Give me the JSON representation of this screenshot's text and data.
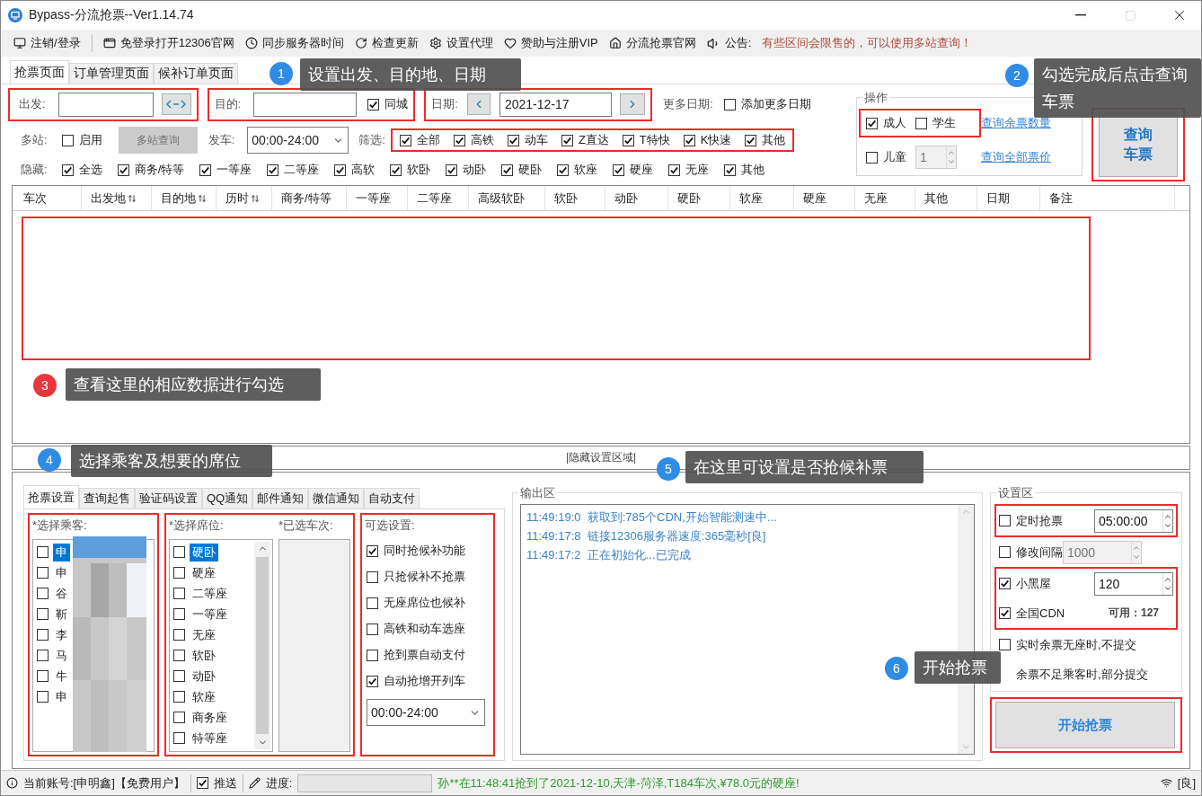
{
  "window": {
    "title": "Bypass-分流抢票--Ver1.14.74"
  },
  "toolbar": [
    {
      "kind": "monitor",
      "label": "注销/登录"
    },
    {
      "kind": "window",
      "label": "免登录打开12306官网"
    },
    {
      "kind": "clock",
      "label": "同步服务器时间"
    },
    {
      "kind": "refresh",
      "label": "检查更新"
    },
    {
      "kind": "gear",
      "label": "设置代理"
    },
    {
      "kind": "heart",
      "label": "赞助与注册VIP"
    },
    {
      "kind": "home",
      "label": "分流抢票官网"
    }
  ],
  "notice": {
    "label": "公告:",
    "text": "有些区间会限售的，可以使用多站查询！"
  },
  "tabs": [
    {
      "label": "抢票页面",
      "selected": true
    },
    {
      "label": "订单管理页面",
      "selected": false
    },
    {
      "label": "候补订单页面",
      "selected": false
    }
  ],
  "query": {
    "from": {
      "label": "出发:"
    },
    "to": {
      "label": "目的:"
    },
    "same_city": {
      "label": "同城",
      "checked": true
    },
    "date": {
      "label": "日期:",
      "value": "2021-12-17"
    },
    "more_dates": {
      "label": "更多日期:",
      "option": {
        "label": "添加更多日期",
        "checked": false
      }
    },
    "multi_station": {
      "label": "多站:",
      "enable": {
        "label": "启用",
        "checked": false
      },
      "button": {
        "label": "多站查询",
        "disabled": true
      }
    },
    "depart": {
      "label": "发车:",
      "value": "00:00-24:00"
    },
    "filter": {
      "label": "筛选:",
      "options": [
        {
          "label": "全部",
          "checked": true
        },
        {
          "label": "高铁",
          "checked": true
        },
        {
          "label": "动车",
          "checked": true
        },
        {
          "label": "Z直达",
          "checked": true
        },
        {
          "label": "T特快",
          "checked": true
        },
        {
          "label": "K快速",
          "checked": true
        },
        {
          "label": "其他",
          "checked": true
        }
      ]
    },
    "hide": {
      "label": "隐藏:",
      "options": [
        {
          "label": "全选",
          "checked": true
        },
        {
          "label": "商务/特等",
          "checked": true
        },
        {
          "label": "一等座",
          "checked": true
        },
        {
          "label": "二等座",
          "checked": true
        },
        {
          "label": "高软",
          "checked": true
        },
        {
          "label": "软卧",
          "checked": true
        },
        {
          "label": "动卧",
          "checked": true
        },
        {
          "label": "硬卧",
          "checked": true
        },
        {
          "label": "软座",
          "checked": true
        },
        {
          "label": "硬座",
          "checked": true
        },
        {
          "label": "无座",
          "checked": true
        },
        {
          "label": "其他",
          "checked": true
        }
      ]
    }
  },
  "operations": {
    "title": "操作",
    "adult": {
      "label": "成人",
      "checked": true
    },
    "student": {
      "label": "学生",
      "checked": false
    },
    "child": {
      "label": "儿童",
      "checked": false,
      "count": "1"
    },
    "links": [
      "查询余票数量",
      "查询全部票价"
    ],
    "query_button": "查询车票"
  },
  "table": {
    "columns": [
      {
        "label": "车次",
        "sortable": false
      },
      {
        "label": "出发地",
        "sortable": true
      },
      {
        "label": "目的地",
        "sortable": true
      },
      {
        "label": "历时",
        "sortable": true
      },
      {
        "label": "商务/特等",
        "sortable": false
      },
      {
        "label": "一等座",
        "sortable": false
      },
      {
        "label": "二等座",
        "sortable": false
      },
      {
        "label": "高级软卧",
        "sortable": false
      },
      {
        "label": "软卧",
        "sortable": false
      },
      {
        "label": "动卧",
        "sortable": false
      },
      {
        "label": "硬卧",
        "sortable": false
      },
      {
        "label": "软座",
        "sortable": false
      },
      {
        "label": "硬座",
        "sortable": false
      },
      {
        "label": "无座",
        "sortable": false
      },
      {
        "label": "其他",
        "sortable": false
      },
      {
        "label": "日期",
        "sortable": false
      },
      {
        "label": "备注",
        "sortable": false
      }
    ]
  },
  "hidden_bar": "|隐藏设置区域|",
  "bottom_tabs": [
    {
      "label": "抢票设置",
      "selected": true
    },
    {
      "label": "查询起售",
      "selected": false
    },
    {
      "label": "验证码设置",
      "selected": false
    },
    {
      "label": "QQ通知",
      "selected": false
    },
    {
      "label": "邮件通知",
      "selected": false
    },
    {
      "label": "微信通知",
      "selected": false
    },
    {
      "label": "自动支付",
      "selected": false
    }
  ],
  "passengers": {
    "title": "*选择乘客:",
    "items": [
      {
        "name": "申",
        "checked": false,
        "selected": true
      },
      {
        "name": "申",
        "checked": false,
        "selected": false
      },
      {
        "name": "谷",
        "checked": false,
        "selected": false
      },
      {
        "name": "靳",
        "checked": false,
        "selected": false
      },
      {
        "name": "李",
        "checked": false,
        "selected": false
      },
      {
        "name": "马",
        "checked": false,
        "selected": false
      },
      {
        "name": "牛",
        "checked": false,
        "selected": false
      },
      {
        "name": "申",
        "checked": false,
        "selected": false
      }
    ]
  },
  "seats": {
    "title": "*选择席位:",
    "items": [
      {
        "label": "硬卧",
        "checked": false,
        "selected": true
      },
      {
        "label": "硬座",
        "checked": false,
        "selected": false
      },
      {
        "label": "二等座",
        "checked": false,
        "selected": false
      },
      {
        "label": "一等座",
        "checked": false,
        "selected": false
      },
      {
        "label": "无座",
        "checked": false,
        "selected": false
      },
      {
        "label": "软卧",
        "checked": false,
        "selected": false
      },
      {
        "label": "动卧",
        "checked": false,
        "selected": false
      },
      {
        "label": "软座",
        "checked": false,
        "selected": false
      },
      {
        "label": "商务座",
        "checked": false,
        "selected": false
      },
      {
        "label": "特等座",
        "checked": false,
        "selected": false
      }
    ]
  },
  "trains": {
    "title": "*已选车次:"
  },
  "options": {
    "title": "可选设置:",
    "items": [
      {
        "label": "同时抢候补功能",
        "checked": true
      },
      {
        "label": "只抢候补不抢票",
        "checked": false
      },
      {
        "label": "无座席位也候补",
        "checked": false
      },
      {
        "label": "高铁和动车选座",
        "checked": false
      },
      {
        "label": "抢到票自动支付",
        "checked": false
      },
      {
        "label": "自动抢增开列车",
        "checked": true
      }
    ],
    "time": "00:00-24:00"
  },
  "output": {
    "title": "输出区",
    "lines": [
      {
        "time": "11:49:19:0",
        "text": "获取到:785个CDN,开始智能测速中..."
      },
      {
        "time": "11:49:17:8",
        "text": "链接12306服务器速度:365毫秒[良]"
      },
      {
        "time": "11:49:17:2",
        "text": "正在初始化...已完成"
      }
    ]
  },
  "settings": {
    "title": "设置区",
    "rows": [
      {
        "kind": "spin",
        "label": "定时抢票",
        "checked": false,
        "value": "05:00:00",
        "disabled": false
      },
      {
        "kind": "spin",
        "label": "修改间隔",
        "checked": false,
        "value": "1000",
        "disabled": true
      },
      {
        "kind": "spin",
        "label": "小黑屋",
        "checked": true,
        "value": "120",
        "disabled": false
      },
      {
        "kind": "note",
        "label": "全国CDN",
        "checked": true,
        "note": "可用：127"
      },
      {
        "kind": "check",
        "label": "实时余票无座时,不提交",
        "checked": false
      },
      {
        "kind": "text",
        "label": "余票不足乘客时,部分提交"
      }
    ],
    "start_button": "开始抢票"
  },
  "status_bar": {
    "account": "当前账号:[申明鑫]【免费用户】",
    "push": {
      "label": "推送",
      "checked": true
    },
    "progress": {
      "label": "进度:",
      "level": 0
    },
    "message": "孙**在11:48:41抢到了2021-12-10,天津-菏泽,T184车次,¥78.0元的硬座!",
    "signal": "[良]"
  },
  "annotations": [
    {
      "number": "1",
      "text": "设置出发、目的地、日期",
      "color": "#2f8ce4"
    },
    {
      "number": "2",
      "text": "勾选完成后点击查询车票",
      "color": "#2f8ce4"
    },
    {
      "number": "3",
      "text": "查看这里的相应数据进行勾选",
      "color": "#e8363c"
    },
    {
      "number": "4",
      "text": "选择乘客及想要的席位",
      "color": "#2f8ce4"
    },
    {
      "number": "5",
      "text": "在这里可设置是否抢候补票",
      "color": "#2f8ce4"
    },
    {
      "number": "6",
      "text": "开始抢票",
      "color": "#2f8ce4"
    }
  ]
}
